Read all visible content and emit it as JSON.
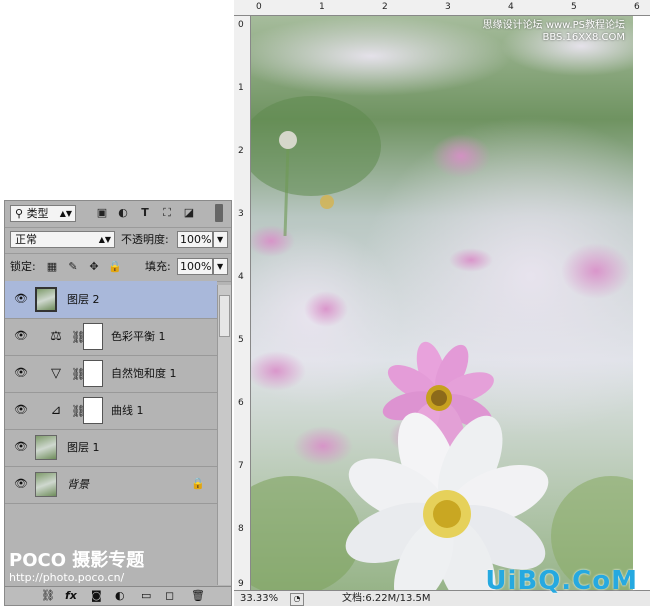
{
  "panel": {
    "filter_kind": "类型",
    "blend_mode": "正常",
    "opacity_label": "不透明度:",
    "opacity_value": "100%",
    "lock_label": "锁定:",
    "fill_label": "填充:",
    "fill_value": "100%",
    "layers": [
      {
        "name": "图层 2",
        "kind": "pixel",
        "selected": true
      },
      {
        "name": "色彩平衡 1",
        "kind": "adjustment",
        "icon": "balance-icon"
      },
      {
        "name": "自然饱和度 1",
        "kind": "adjustment",
        "icon": "vibrance-triangle-icon"
      },
      {
        "name": "曲线 1",
        "kind": "adjustment",
        "icon": "curves-icon"
      },
      {
        "name": "图层 1",
        "kind": "pixel"
      },
      {
        "name": "背景",
        "kind": "pixel",
        "locked": true
      }
    ]
  },
  "canvas": {
    "ruler_top": [
      "0",
      "1",
      "2",
      "3",
      "4",
      "5",
      "6"
    ],
    "ruler_left": [
      "0",
      "1",
      "2",
      "3",
      "4",
      "5",
      "6",
      "7",
      "8",
      "9"
    ],
    "zoom": "33.33%",
    "doc_info": "文档:6.22M/13.5M"
  },
  "watermarks": {
    "top_line1": "思缘设计论坛 www.PS教程论坛",
    "top_line2": "BBS.16XX8.COM",
    "poco_brand": "POCO 摄影专题",
    "poco_url": "http://photo.poco.cn/",
    "uibq": "UiBQ.CoM"
  },
  "colors": {
    "selected_row": "#a9b8da",
    "watermark_blue": "#26a9e0"
  }
}
